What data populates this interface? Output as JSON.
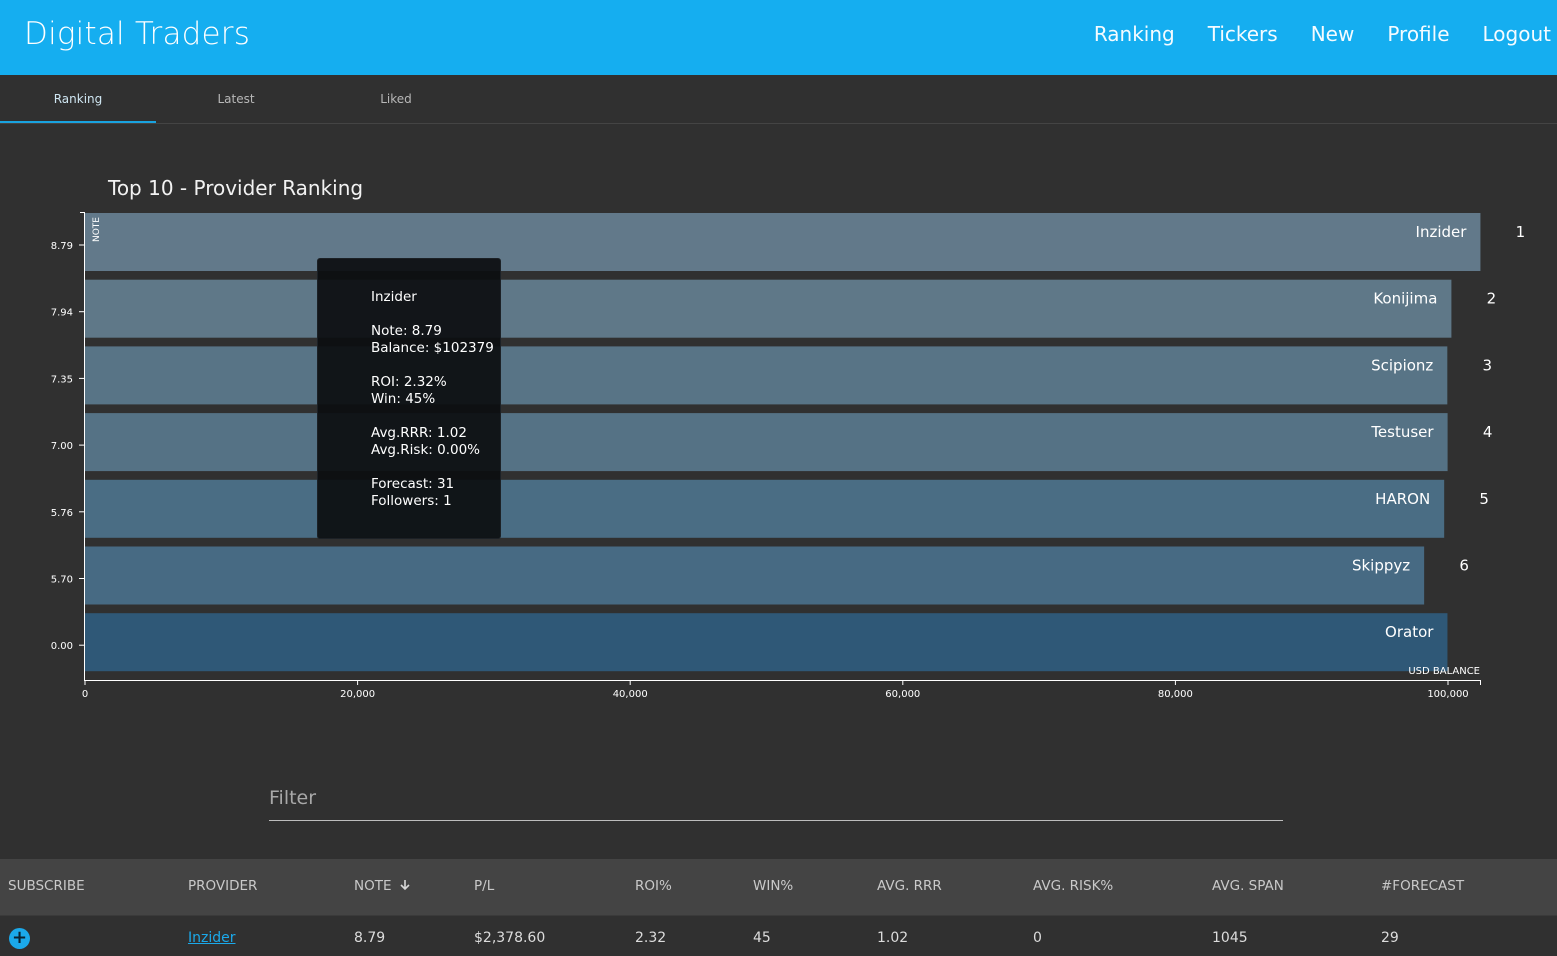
{
  "app": {
    "brand": "Digital Traders",
    "nav": [
      "Ranking",
      "Tickers",
      "New",
      "Profile",
      "Logout"
    ]
  },
  "tabs": [
    "Ranking",
    "Latest",
    "Liked"
  ],
  "chart_data": {
    "type": "bar",
    "orientation": "horizontal",
    "title": "Top 10 - Provider Ranking",
    "ylabel": "NOTE",
    "xlabel": "USD BALANCE",
    "x_ticks": [
      "0",
      "20,000",
      "40,000",
      "60,000",
      "80,000",
      "100,000"
    ],
    "xlim": [
      0,
      102379
    ],
    "categories": [
      "Inzider",
      "Konijima",
      "Scipionz",
      "Testuser",
      "HARON",
      "Skippyz",
      "Orator"
    ],
    "notes": [
      "8.79",
      "7.94",
      "7.35",
      "7.00",
      "5.76",
      "5.70",
      "0.00"
    ],
    "ranks": [
      "1",
      "2",
      "3",
      "4",
      "5",
      "6",
      ""
    ],
    "values": [
      102379,
      100250,
      99950,
      99970,
      99720,
      98250,
      99960
    ],
    "colors": {
      "bars": [
        "#62798a",
        "#5f7888",
        "#587486",
        "#557285",
        "#4a6d84",
        "#476a83",
        "#2f5877"
      ],
      "axis": "#ffffff"
    }
  },
  "tooltip": {
    "name": "Inzider",
    "note": "Note: 8.79",
    "balance": "Balance: $102379",
    "roi": "ROI: 2.32%",
    "win": "Win: 45%",
    "rrr": "Avg.RRR: 1.02",
    "risk": "Avg.Risk: 0.00%",
    "forecast": "Forecast: 31",
    "followers": "Followers: 1"
  },
  "filter": {
    "placeholder": "Filter"
  },
  "table": {
    "sort_icon": "arrow-down-icon",
    "headers": [
      "SUBSCRIBE",
      "PROVIDER",
      "NOTE",
      "P/L",
      "ROI%",
      "WIN%",
      "AVG. RRR",
      "AVG. RISK%",
      "AVG. SPAN",
      "#FORECAST"
    ],
    "row": {
      "subscribe_icon": "plus-icon",
      "subscribe_symbol": "+",
      "provider": "Inzider",
      "note": "8.79",
      "pl": "$2,378.60",
      "roi": "2.32",
      "win": "45",
      "rrr": "1.02",
      "risk": "0",
      "span": "1045",
      "forecast": "29"
    }
  }
}
